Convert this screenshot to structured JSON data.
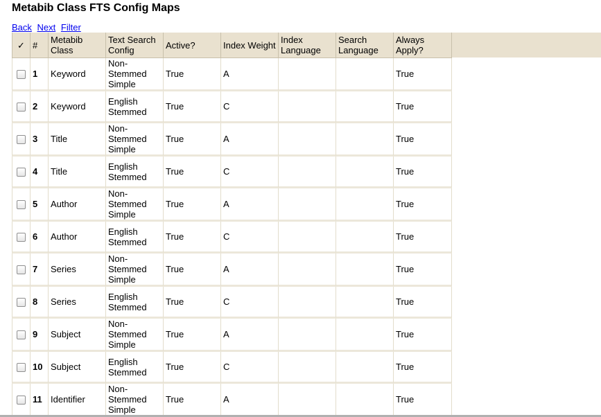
{
  "page": {
    "title": "Metabib Class FTS Config Maps"
  },
  "nav": {
    "back": "Back",
    "next": "Next",
    "filter": "Filter"
  },
  "columns": {
    "select": "✓",
    "id": "#",
    "metabib_class": "Metabib Class",
    "text_search_config": "Text Search Config",
    "active": "Active?",
    "index_weight": "Index Weight",
    "index_language": "Index Language",
    "search_language": "Search Language",
    "always_apply": "Always Apply?"
  },
  "rows": [
    {
      "id": "1",
      "metabib_class": "Keyword",
      "config": "Non-Stemmed Simple",
      "active": "True",
      "weight": "A",
      "index_language": "",
      "search_language": "",
      "always_apply": "True"
    },
    {
      "id": "2",
      "metabib_class": "Keyword",
      "config": "English Stemmed",
      "active": "True",
      "weight": "C",
      "index_language": "",
      "search_language": "",
      "always_apply": "True"
    },
    {
      "id": "3",
      "metabib_class": "Title",
      "config": "Non-Stemmed Simple",
      "active": "True",
      "weight": "A",
      "index_language": "",
      "search_language": "",
      "always_apply": "True"
    },
    {
      "id": "4",
      "metabib_class": "Title",
      "config": "English Stemmed",
      "active": "True",
      "weight": "C",
      "index_language": "",
      "search_language": "",
      "always_apply": "True"
    },
    {
      "id": "5",
      "metabib_class": "Author",
      "config": "Non-Stemmed Simple",
      "active": "True",
      "weight": "A",
      "index_language": "",
      "search_language": "",
      "always_apply": "True"
    },
    {
      "id": "6",
      "metabib_class": "Author",
      "config": "English Stemmed",
      "active": "True",
      "weight": "C",
      "index_language": "",
      "search_language": "",
      "always_apply": "True"
    },
    {
      "id": "7",
      "metabib_class": "Series",
      "config": "Non-Stemmed Simple",
      "active": "True",
      "weight": "A",
      "index_language": "",
      "search_language": "",
      "always_apply": "True"
    },
    {
      "id": "8",
      "metabib_class": "Series",
      "config": "English Stemmed",
      "active": "True",
      "weight": "C",
      "index_language": "",
      "search_language": "",
      "always_apply": "True"
    },
    {
      "id": "9",
      "metabib_class": "Subject",
      "config": "Non-Stemmed Simple",
      "active": "True",
      "weight": "A",
      "index_language": "",
      "search_language": "",
      "always_apply": "True"
    },
    {
      "id": "10",
      "metabib_class": "Subject",
      "config": "English Stemmed",
      "active": "True",
      "weight": "C",
      "index_language": "",
      "search_language": "",
      "always_apply": "True"
    },
    {
      "id": "11",
      "metabib_class": "Identifier",
      "config": "Non-Stemmed Simple",
      "active": "True",
      "weight": "A",
      "index_language": "",
      "search_language": "",
      "always_apply": "True"
    }
  ],
  "colors": {
    "header_bg": "#e9e1cf",
    "link": "#0000ee"
  }
}
